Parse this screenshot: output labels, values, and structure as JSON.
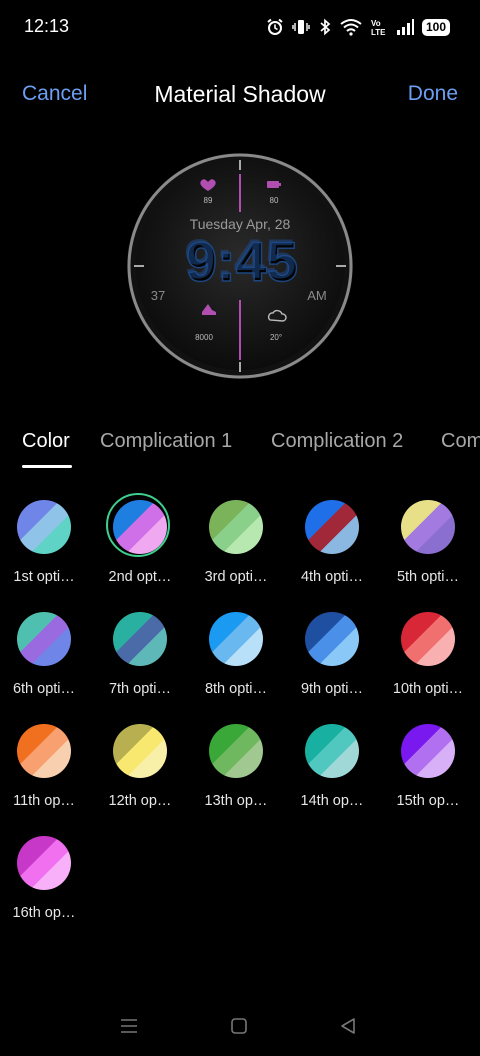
{
  "status_bar": {
    "time": "12:13",
    "battery": "100"
  },
  "header": {
    "cancel": "Cancel",
    "title": "Material Shadow",
    "done": "Done"
  },
  "watch_face": {
    "date": "Tuesday Apr, 28",
    "time": "9:45",
    "left_number": "37",
    "ampm": "AM",
    "heart_value": "89",
    "battery_value": "80",
    "steps_value": "8000",
    "weather_value": "20°"
  },
  "tabs": [
    {
      "label": "Color",
      "active": true
    },
    {
      "label": "Complication 1",
      "active": false
    },
    {
      "label": "Complication 2",
      "active": false
    },
    {
      "label": "Com",
      "active": false
    }
  ],
  "options": [
    {
      "label": "1st opti…",
      "c1": "#6f86e8",
      "c2": "#8fc3e8",
      "c3": "#5fd3c6",
      "selected": false
    },
    {
      "label": "2nd opt…",
      "c1": "#1f7fe0",
      "c2": "#d070e8",
      "c3": "#f0a8f0",
      "selected": true
    },
    {
      "label": "3rd opti…",
      "c1": "#7bb35a",
      "c2": "#8ad08a",
      "c3": "#b6e8b0",
      "selected": false
    },
    {
      "label": "4th opti…",
      "c1": "#1f6fe8",
      "c2": "#a02838",
      "c3": "#8ab8e0",
      "selected": false
    },
    {
      "label": "5th opti…",
      "c1": "#e8e088",
      "c2": "#a27ae0",
      "c3": "#8a6fd0",
      "selected": false
    },
    {
      "label": "6th opti…",
      "c1": "#4fc0b0",
      "c2": "#9a6ae0",
      "c3": "#6f86e8",
      "selected": false
    },
    {
      "label": "7th opti…",
      "c1": "#2ab0a0",
      "c2": "#4a6aa8",
      "c3": "#5fb8b8",
      "selected": false
    },
    {
      "label": "8th opti…",
      "c1": "#1a9af0",
      "c2": "#6ab8f0",
      "c3": "#b8e0f8",
      "selected": false
    },
    {
      "label": "9th opti…",
      "c1": "#1f4fa0",
      "c2": "#4a90e8",
      "c3": "#8ac8f8",
      "selected": false
    },
    {
      "label": "10th opti…",
      "c1": "#d82838",
      "c2": "#f07070",
      "c3": "#f8b0b0",
      "selected": false
    },
    {
      "label": "11th op…",
      "c1": "#f07020",
      "c2": "#f8a070",
      "c3": "#f8d0b0",
      "selected": false
    },
    {
      "label": "12th op…",
      "c1": "#b8b050",
      "c2": "#f8e870",
      "c3": "#f8f0a8",
      "selected": false
    },
    {
      "label": "13th op…",
      "c1": "#3aa838",
      "c2": "#70b860",
      "c3": "#a0c890",
      "selected": false
    },
    {
      "label": "14th op…",
      "c1": "#18b0a0",
      "c2": "#50c8c0",
      "c3": "#a0d8d8",
      "selected": false
    },
    {
      "label": "15th op…",
      "c1": "#7a18f0",
      "c2": "#b070f0",
      "c3": "#d8b0f8",
      "selected": false
    },
    {
      "label": "16th op…",
      "c1": "#c838c8",
      "c2": "#f070f0",
      "c3": "#f8b0f8",
      "selected": false
    }
  ],
  "colors": {
    "accent_link": "#6c9ef2",
    "selected_ring": "#3ecf8e",
    "watch_time": "#1d4a8a",
    "complication_accent": "#b04fb0"
  }
}
